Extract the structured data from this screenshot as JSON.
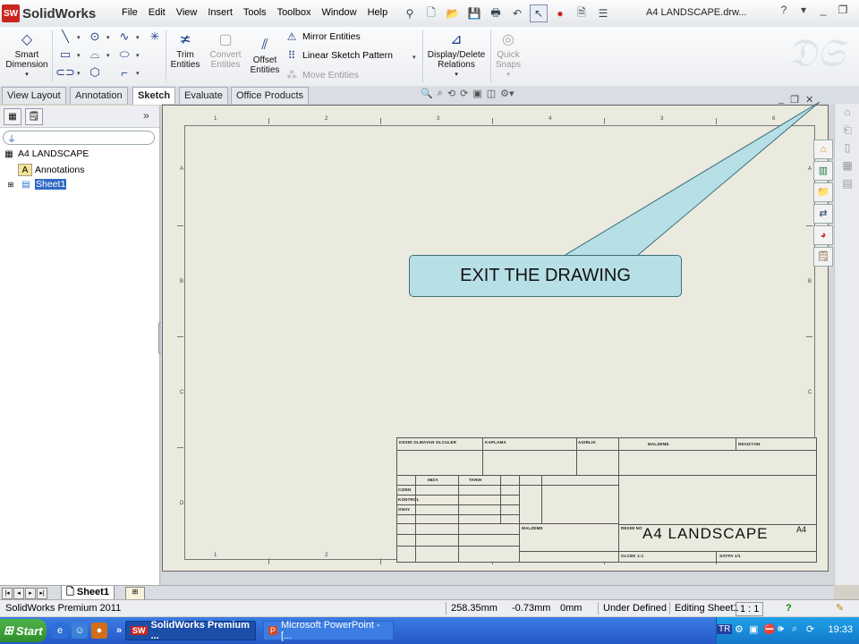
{
  "app": {
    "logo_text": "SolidWorks",
    "menus": [
      "File",
      "Edit",
      "View",
      "Insert",
      "Tools",
      "Toolbox",
      "Window",
      "Help"
    ],
    "doc_title": "A4 LANDSCAPE.drw...",
    "help_glyph": "?"
  },
  "command_manager": {
    "smart_dimension": "Smart\nDimension",
    "trim": "Trim\nEntities",
    "convert": "Convert\nEntities",
    "offset": "Offset\nEntities",
    "mirror": "Mirror Entities",
    "linear_pattern": "Linear Sketch Pattern",
    "move": "Move Entities",
    "display_relations": "Display/Delete\nRelations",
    "quick_snaps": "Quick\nSnaps"
  },
  "tabs": [
    "View Layout",
    "Annotation",
    "Sketch",
    "Evaluate",
    "Office Products"
  ],
  "active_tab": "Sketch",
  "feature_tree": {
    "root": "A4 LANDSCAPE",
    "items": [
      "Annotations",
      "Sheet1"
    ]
  },
  "drawing": {
    "zone_numbers": [
      "1",
      "2",
      "3",
      "4",
      "3",
      "6"
    ],
    "zone_letters": [
      "A",
      "B",
      "C",
      "D"
    ],
    "title_block": {
      "name": "A4 LANDSCAPE",
      "size": "A4",
      "small_text": [
        "KESIN OLMAYAN OLCULER",
        "IMZA",
        "TARIH",
        "CIZEN",
        "KONTROL",
        "ONAY",
        "MALZEME",
        "REVIZYON",
        "RESIM NO",
        "OLCEK 1:1",
        "SAYFA 1/1",
        "AGIRLIK",
        "KAPLAMA"
      ]
    }
  },
  "callout": {
    "text": "EXIT THE DRAWING"
  },
  "sheet_tabs": {
    "active": "Sheet1"
  },
  "status_bar": {
    "product": "SolidWorks Premium 2011",
    "x": "258.35mm",
    "y": "-0.73mm",
    "z": "0mm",
    "state": "Under Defined",
    "editing": "Editing Sheet1",
    "scale": "1 : 1"
  },
  "taskbar": {
    "start": "Start",
    "tasks": [
      "SolidWorks Premium ...",
      "Microsoft PowerPoint - [..."
    ],
    "language": "TR",
    "clock": "19:33"
  }
}
